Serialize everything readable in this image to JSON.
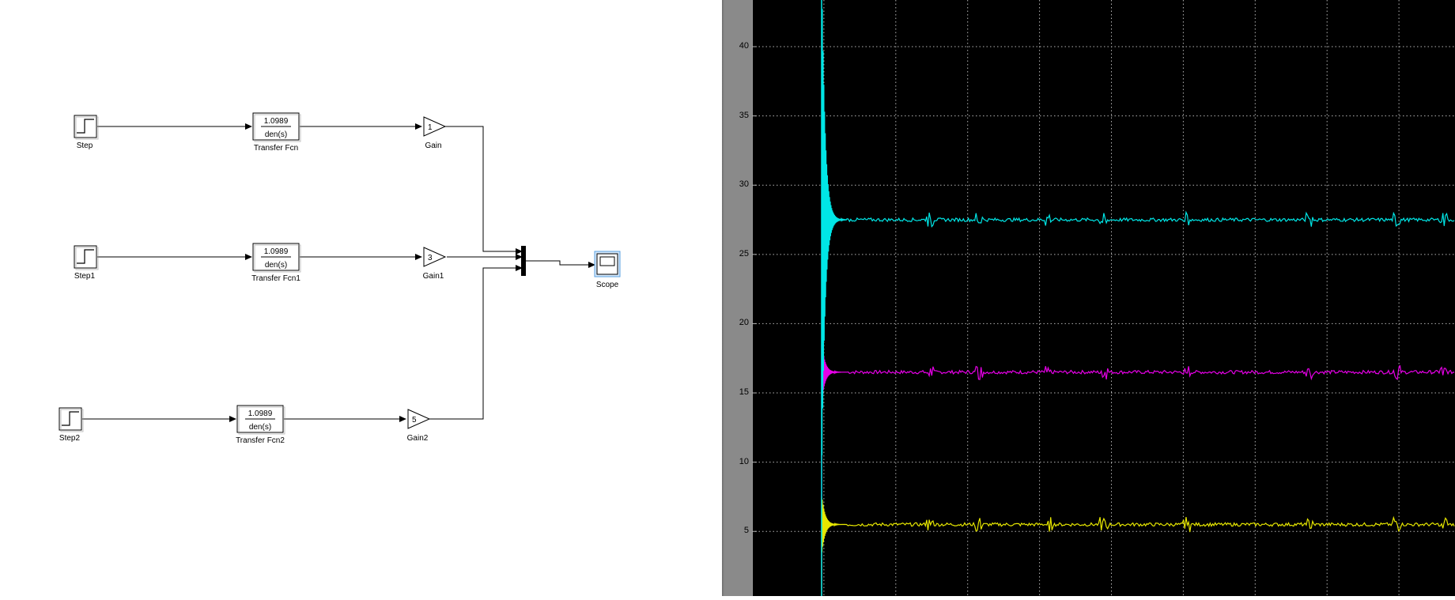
{
  "model": {
    "blocks": {
      "step": {
        "label": "Step"
      },
      "step1": {
        "label": "Step1"
      },
      "step2": {
        "label": "Step2"
      },
      "tf": {
        "numerator": "1.0989",
        "denominator": "den(s)",
        "label": "Transfer Fcn"
      },
      "tf1": {
        "numerator": "1.0989",
        "denominator": "den(s)",
        "label": "Transfer Fcn1"
      },
      "tf2": {
        "numerator": "1.0989",
        "denominator": "den(s)",
        "label": "Transfer Fcn2"
      },
      "gain": {
        "value": "1",
        "label": "Gain"
      },
      "gain1": {
        "value": "3",
        "label": "Gain1"
      },
      "gain2": {
        "value": "5",
        "label": "Gain2"
      },
      "scope": {
        "label": "Scope"
      }
    }
  },
  "scope_plot": {
    "colors": {
      "background": "#000000",
      "grid": "#b4b4b4",
      "cyan": "#00e6e6",
      "magenta": "#e600e6",
      "yellow": "#e6e600"
    },
    "y_ticks": [
      "40",
      "35",
      "30",
      "25",
      "20",
      "15",
      "10",
      "5"
    ],
    "grid": true
  },
  "chart_data": {
    "type": "line",
    "title": "",
    "xlabel": "",
    "ylabel": "",
    "ylim": [
      2,
      44.5
    ],
    "y_ticks": [
      5,
      10,
      15,
      20,
      25,
      30,
      35,
      40
    ],
    "series": [
      {
        "color": "cyan",
        "steady_value": 27.5,
        "peak": 44.5
      },
      {
        "color": "magenta",
        "steady_value": 16.5,
        "peak": 18.5
      },
      {
        "color": "yellow",
        "steady_value": 5.5,
        "peak": 7.5
      }
    ]
  }
}
